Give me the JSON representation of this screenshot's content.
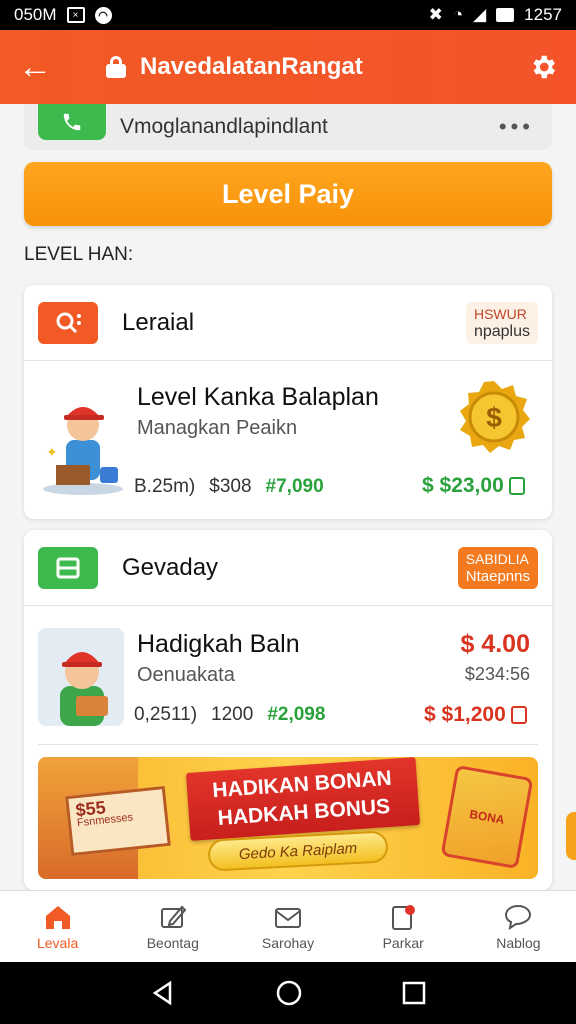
{
  "status_bar": {
    "left_text": "050M",
    "time": "1257"
  },
  "app_bar": {
    "title": "NavedalatanRangat"
  },
  "top_card": {
    "text": "Vmoglanandlapindlant"
  },
  "pay_button": {
    "label": "Level Paiy"
  },
  "section_label": "LEVEL HAN:",
  "card1": {
    "header_title": "Leraial",
    "badge_line1": "HSWUR",
    "badge_line2": "npaplus",
    "item_title": "Level Kanka Balaplan",
    "item_subtitle": "Managkan Peaikn",
    "meta_a": "B.25m)",
    "meta_b": "$308",
    "meta_c": "#7,090",
    "price": "$ $23,00"
  },
  "card2": {
    "header_title": "Gevaday",
    "badge_line1": "SABIDLIA",
    "badge_line2": "Ntaepnns",
    "item_title": "Hadigkah Baln",
    "item_subtitle": "Oenuakata",
    "meta_a": "0,2511)",
    "meta_b": "1200",
    "meta_c": "#2,098",
    "price_top": "$ 4.00",
    "price_mid": "$234:56",
    "price_bottom": "$ $1,200",
    "banner": {
      "sign_big": "$55",
      "sign_small": "Fsnmesses",
      "ribbon_line1": "HADIKAN BONAN",
      "ribbon_line2": "HADKAH BONUS",
      "pill": "Gedo Ka Raiplam",
      "tag": "BONA"
    }
  },
  "bottom_nav": [
    {
      "label": "Levala"
    },
    {
      "label": "Beontag"
    },
    {
      "label": "Sarohay"
    },
    {
      "label": "Parkar"
    },
    {
      "label": "Nablog"
    }
  ],
  "colors": {
    "brand": "#f15a24",
    "accent": "#f7930a",
    "green": "#2aa23c",
    "red": "#d8341f"
  }
}
